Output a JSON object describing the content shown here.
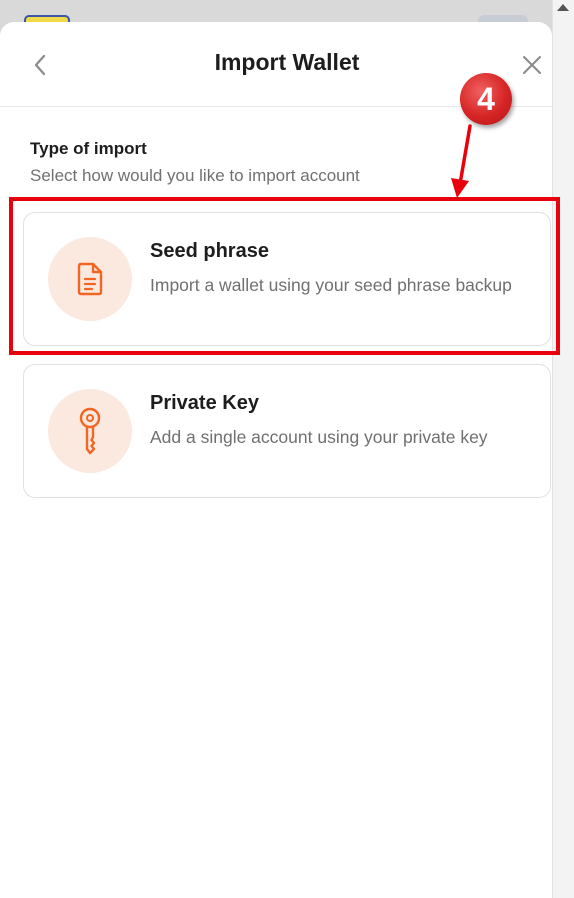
{
  "header": {
    "title": "Import Wallet"
  },
  "section": {
    "title": "Type of import",
    "subtitle": "Select how would you like to import account"
  },
  "options": [
    {
      "title": "Seed phrase",
      "description": "Import a wallet using your seed phrase backup",
      "icon": "document-icon"
    },
    {
      "title": "Private Key",
      "description": "Add a single account using your private key",
      "icon": "key-icon"
    }
  ],
  "annotation": {
    "step_number": "4",
    "highlight_color": "#e8000c"
  },
  "colors": {
    "accent": "#f26522",
    "icon_bg": "#fbe9e0",
    "text_primary": "#1d1d1d",
    "text_secondary": "#707070"
  }
}
